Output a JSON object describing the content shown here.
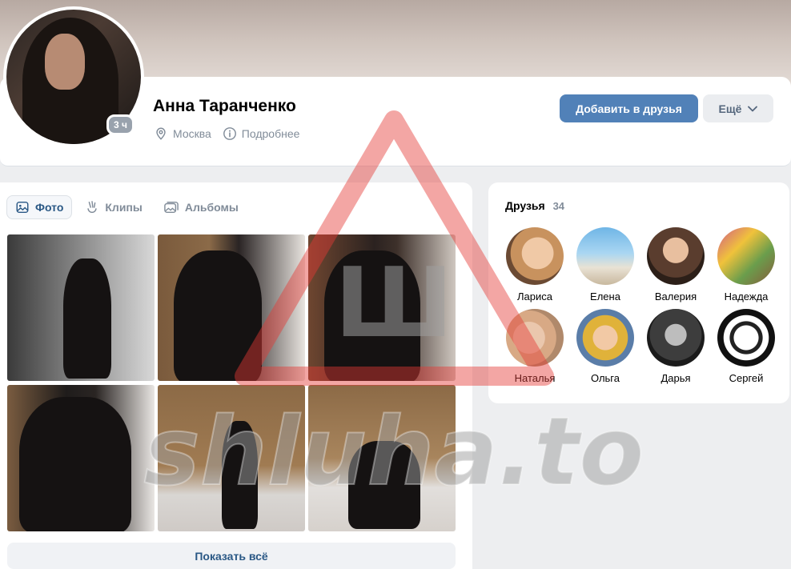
{
  "profile": {
    "name": "Анна Таранченко",
    "online_badge": "3 ч",
    "location": "Москва",
    "details_link": "Подробнее",
    "add_friend_button": "Добавить в друзья",
    "more_button": "Ещё"
  },
  "photos": {
    "tabs": [
      {
        "label": "Фото",
        "icon": "photo-icon",
        "active": true
      },
      {
        "label": "Клипы",
        "icon": "clips-icon",
        "active": false
      },
      {
        "label": "Альбомы",
        "icon": "albums-icon",
        "active": false
      }
    ],
    "show_all": "Показать всё"
  },
  "friends": {
    "title": "Друзья",
    "count": "34",
    "items": [
      {
        "name": "Лариса"
      },
      {
        "name": "Елена"
      },
      {
        "name": "Валерия"
      },
      {
        "name": "Надежда"
      },
      {
        "name": "Наталья"
      },
      {
        "name": "Ольга"
      },
      {
        "name": "Дарья"
      },
      {
        "name": "Сергей"
      }
    ]
  },
  "watermark": {
    "text": "shluha.to",
    "symbol": "Ш"
  },
  "colors": {
    "accent": "#5181b8",
    "link": "#2a5885",
    "secondary_text": "#818c99",
    "page_background": "#edeef0",
    "watermark_red": "#e53935"
  }
}
